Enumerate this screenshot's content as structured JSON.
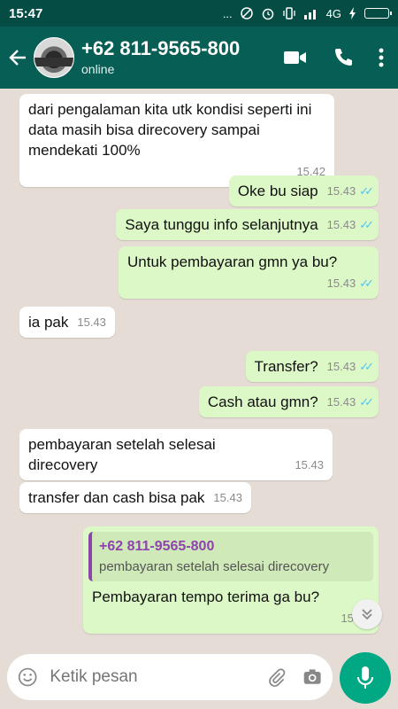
{
  "status_bar": {
    "time": "15:47",
    "dots": "...",
    "network": "4G"
  },
  "header": {
    "title": "+62 811-9565-800",
    "subtitle": "online"
  },
  "icons": {
    "back": "arrow-left-icon",
    "avatar": "contact-avatar",
    "video": "video-call-icon",
    "call": "phone-icon",
    "menu": "more-vert-icon",
    "emoji": "emoji-icon",
    "attach": "paperclip-icon",
    "camera": "camera-icon",
    "mic": "mic-icon",
    "scroll": "chevron-double-down-icon"
  },
  "colors": {
    "header": "#075e54",
    "status": "#054d44",
    "outgoing": "#dcf8c6",
    "incoming": "#ffffff",
    "accent": "#00a884",
    "ticks": "#4fc3f7",
    "quote_accent": "#8e44ad"
  },
  "messages": [
    {
      "dir": "in",
      "text": "dari pengalaman kita utk kondisi seperti ini data masih bisa direcovery sampai mendekati 100%",
      "time": "15.42"
    },
    {
      "dir": "out",
      "text": "Oke  bu siap",
      "time": "15.43"
    },
    {
      "dir": "out",
      "text": "Saya tunggu  info selanjutnya",
      "time": "15.43"
    },
    {
      "dir": "out",
      "text": "Untuk pembayaran gmn ya bu?",
      "time": "15.43"
    },
    {
      "dir": "in",
      "text": "ia pak",
      "time": "15.43"
    },
    {
      "dir": "out",
      "text": "Transfer?",
      "time": "15.43"
    },
    {
      "dir": "out",
      "text": "Cash  atau  gmn?",
      "time": "15.43"
    },
    {
      "dir": "in",
      "text": "pembayaran setelah selesai direcovery",
      "time": "15.43"
    },
    {
      "dir": "in",
      "text": "transfer dan cash bisa pak",
      "time": "15.43"
    },
    {
      "dir": "out",
      "quote_name": "+62 811-9565-800",
      "quote_text": "pembayaran setelah selesai direcovery",
      "text": "Pembayaran  tempo  terima  ga bu?",
      "time": "15.44"
    }
  ],
  "input": {
    "placeholder": "Ketik pesan"
  }
}
